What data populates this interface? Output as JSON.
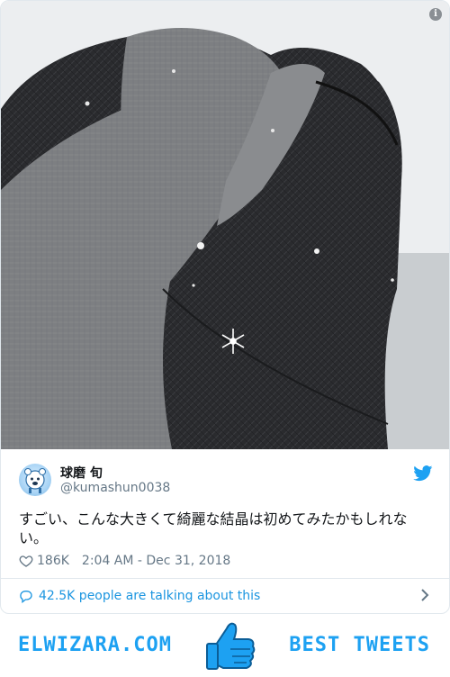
{
  "tweet": {
    "display_name": "球磨 旬",
    "handle": "@kumashun0038",
    "text": "すごい、こんな大きくて綺麗な結晶は初めてみたかもしれない。",
    "likes": "186K",
    "timestamp": "2:04 AM - Dec 31, 2018",
    "talking": "42.5K people are talking about this",
    "info_icon": "i"
  },
  "footer": {
    "site": "ELWIZARA.COM",
    "tagline": "BEST TWEETS"
  },
  "icons": [
    "info-icon",
    "avatar",
    "twitter-bird-icon",
    "heart-icon",
    "speech-bubble-icon",
    "chevron-right-icon",
    "thumbs-up-icon"
  ],
  "colors": {
    "accent": "#1da1f2",
    "link": "#1b95e0",
    "muted": "#657786",
    "text": "#14171a",
    "border": "#e1e8ed"
  }
}
